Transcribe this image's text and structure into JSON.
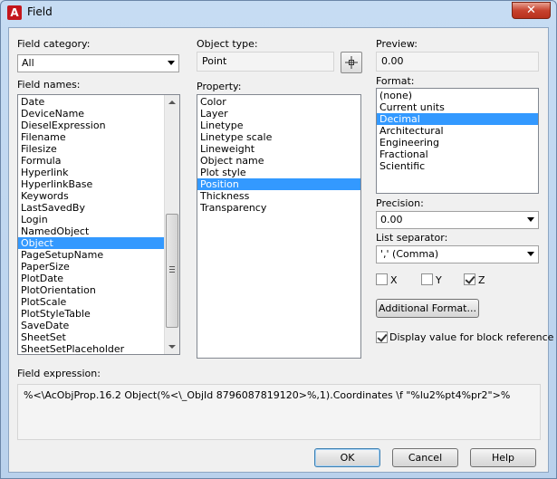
{
  "window": {
    "title": "Field",
    "app_icon": "A",
    "close_glyph": "✕"
  },
  "field_category": {
    "label": "Field category:",
    "value": "All"
  },
  "field_names": {
    "label": "Field names:",
    "items": [
      "Date",
      "DeviceName",
      "DieselExpression",
      "Filename",
      "Filesize",
      "Formula",
      "Hyperlink",
      "HyperlinkBase",
      "Keywords",
      "LastSavedBy",
      "Login",
      "NamedObject",
      "Object",
      "PageSetupName",
      "PaperSize",
      "PlotDate",
      "PlotOrientation",
      "PlotScale",
      "PlotStyleTable",
      "SaveDate",
      "SheetSet",
      "SheetSetPlaceholder"
    ],
    "selected_index": 12
  },
  "object_type": {
    "label": "Object type:",
    "value": "Point"
  },
  "property": {
    "label": "Property:",
    "items": [
      "Color",
      "Layer",
      "Linetype",
      "Linetype scale",
      "Lineweight",
      "Object name",
      "Plot style",
      "Position",
      "Thickness",
      "Transparency"
    ],
    "selected_index": 7
  },
  "preview": {
    "label": "Preview:",
    "value": "0.00"
  },
  "format": {
    "label": "Format:",
    "items": [
      "(none)",
      "Current units",
      "Decimal",
      "Architectural",
      "Engineering",
      "Fractional",
      "Scientific"
    ],
    "selected_index": 2
  },
  "precision": {
    "label": "Precision:",
    "value": "0.00"
  },
  "list_separator": {
    "label": "List separator:",
    "value": "',' (Comma)"
  },
  "axes": {
    "x_label": "X",
    "x_checked": false,
    "y_label": "Y",
    "y_checked": false,
    "z_label": "Z",
    "z_checked": true
  },
  "additional_format_label": "Additional Format...",
  "block_reference": {
    "label": "Display value for block reference",
    "checked": true
  },
  "field_expression": {
    "label": "Field expression:",
    "value": "%<\\AcObjProp.16.2 Object(%<\\_ObjId 8796087819120>%,1).Coordinates \\f \"%lu2%pt4%pr2\">%"
  },
  "buttons": {
    "ok": "OK",
    "cancel": "Cancel",
    "help": "Help"
  },
  "colors": {
    "selection": "#3399ff",
    "close_button": "#c7432f"
  }
}
